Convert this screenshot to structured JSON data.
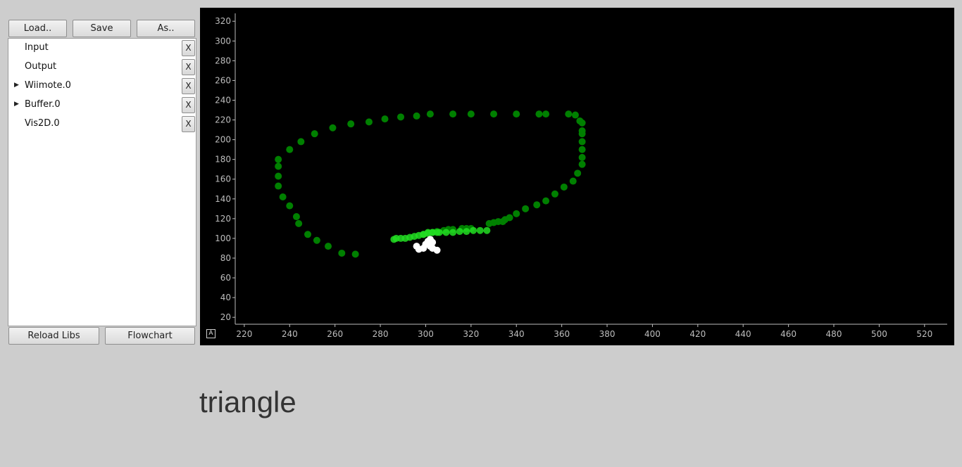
{
  "toolbar": {
    "load_label": "Load..",
    "save_label": "Save",
    "saveas_label": "As.."
  },
  "modules": [
    {
      "label": "Input",
      "expandable": false,
      "remove_label": "X"
    },
    {
      "label": "Output",
      "expandable": false,
      "remove_label": "X"
    },
    {
      "label": "Wiimote.0",
      "expandable": true,
      "remove_label": "X"
    },
    {
      "label": "Buffer.0",
      "expandable": true,
      "remove_label": "X"
    },
    {
      "label": "Vis2D.0",
      "expandable": false,
      "remove_label": "X"
    }
  ],
  "bottom_bar": {
    "reload_label": "Reload Libs",
    "flowchart_label": "Flowchart"
  },
  "plot": {
    "auto_label": "A",
    "colors": {
      "background": "#000000",
      "trail_old": "#008000",
      "trail_recent": "#22dd22",
      "cursor": "#ffffff",
      "axis": "#bdbdbd"
    }
  },
  "chart_data": {
    "type": "scatter",
    "xlim": [
      216,
      530
    ],
    "ylim": [
      13,
      328
    ],
    "xticks": [
      220,
      240,
      260,
      280,
      300,
      320,
      340,
      360,
      380,
      400,
      420,
      440,
      460,
      480,
      500,
      520
    ],
    "yticks": [
      20,
      40,
      60,
      80,
      100,
      120,
      140,
      160,
      180,
      200,
      220,
      240,
      260,
      280,
      300,
      320
    ],
    "series": [
      {
        "points": [
          [
            269,
            84
          ],
          [
            263,
            85
          ],
          [
            257,
            92
          ],
          [
            252,
            98
          ],
          [
            248,
            104
          ],
          [
            244,
            115
          ],
          [
            243,
            122
          ],
          [
            240,
            133
          ],
          [
            237,
            142
          ],
          [
            235,
            153
          ],
          [
            235,
            163
          ],
          [
            235,
            173
          ],
          [
            235,
            180
          ],
          [
            240,
            190
          ],
          [
            245,
            198
          ],
          [
            251,
            206
          ],
          [
            259,
            212
          ],
          [
            267,
            216
          ],
          [
            275,
            218
          ],
          [
            282,
            221
          ],
          [
            289,
            223
          ],
          [
            296,
            224
          ],
          [
            302,
            226
          ],
          [
            312,
            226
          ],
          [
            320,
            226
          ],
          [
            330,
            226
          ],
          [
            340,
            226
          ],
          [
            350,
            226
          ],
          [
            353,
            226
          ],
          [
            363,
            226
          ],
          [
            366,
            225
          ],
          [
            368,
            219
          ],
          [
            369,
            217
          ],
          [
            369,
            209
          ],
          [
            369,
            206
          ],
          [
            369,
            198
          ],
          [
            369,
            190
          ],
          [
            369,
            182
          ],
          [
            369,
            175
          ],
          [
            367,
            166
          ],
          [
            365,
            158
          ],
          [
            361,
            152
          ],
          [
            357,
            145
          ],
          [
            353,
            138
          ],
          [
            349,
            134
          ],
          [
            344,
            130
          ],
          [
            340,
            125
          ],
          [
            337,
            121
          ],
          [
            335,
            119
          ],
          [
            334,
            117
          ],
          [
            332,
            117
          ],
          [
            330,
            116
          ],
          [
            328,
            115
          ],
          [
            320,
            110
          ],
          [
            318,
            110
          ],
          [
            316,
            110
          ],
          [
            312,
            109
          ],
          [
            310,
            109
          ],
          [
            308,
            108
          ],
          [
            305,
            107
          ]
        ]
      },
      {
        "points": [
          [
            305,
            106
          ],
          [
            303,
            106
          ],
          [
            301,
            105
          ],
          [
            299,
            104
          ],
          [
            297,
            103
          ],
          [
            295,
            102
          ],
          [
            293,
            101
          ],
          [
            291,
            100
          ],
          [
            289,
            100
          ],
          [
            287,
            100
          ],
          [
            286,
            99
          ],
          [
            299,
            104
          ],
          [
            301,
            106
          ],
          [
            303,
            106
          ],
          [
            306,
            106
          ],
          [
            309,
            106
          ],
          [
            312,
            106
          ],
          [
            315,
            107
          ],
          [
            318,
            107
          ],
          [
            321,
            108
          ],
          [
            324,
            108
          ],
          [
            327,
            108
          ]
        ]
      },
      {
        "points": [
          [
            296,
            92
          ],
          [
            297,
            89
          ],
          [
            299,
            90
          ],
          [
            300,
            94
          ],
          [
            301,
            97
          ],
          [
            302,
            99
          ],
          [
            303,
            96
          ],
          [
            302,
            92
          ],
          [
            303,
            90
          ],
          [
            305,
            88
          ]
        ]
      }
    ]
  },
  "caption": "triangle"
}
